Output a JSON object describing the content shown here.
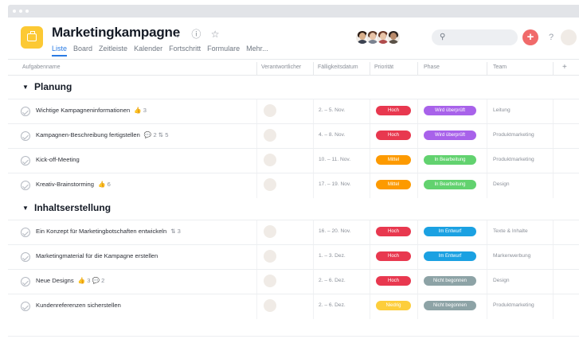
{
  "window": {
    "controls": [
      "dot",
      "dot",
      "dot"
    ]
  },
  "header": {
    "title": "Marketingkampagne",
    "title_icons": [
      "chevron-down-icon",
      "info-icon",
      "star-icon"
    ],
    "tabs": [
      {
        "label": "Liste",
        "active": true
      },
      {
        "label": "Board",
        "active": false
      },
      {
        "label": "Zeitleiste",
        "active": false
      },
      {
        "label": "Kalender",
        "active": false
      },
      {
        "label": "Fortschritt",
        "active": false
      },
      {
        "label": "Formulare",
        "active": false
      },
      {
        "label": "Mehr...",
        "active": false
      }
    ],
    "search": {
      "placeholder": ""
    },
    "plus_label": "+",
    "help_label": "?"
  },
  "columns": {
    "task": "Aufgabenname",
    "assignee": "Verantwortlicher",
    "due": "Fälligkeitsdatum",
    "priority": "Priorität",
    "phase": "Phase",
    "team": "Team",
    "add": "+"
  },
  "colors": {
    "hoch": "#e8384f",
    "mittel": "#fd9a00",
    "niedrig": "#fdce3c",
    "wird_ueberprueft": "#a862ea",
    "in_bearbeitung": "#62d26f",
    "im_entwurf": "#1ba1e2",
    "nicht_begonnen": "#8da3a6",
    "accent": "#2a7be4"
  },
  "sections": [
    {
      "title": "Planung",
      "tasks": [
        {
          "name": "Wichtige Kampagneninformationen",
          "meta": "👍 3",
          "due": "2. – 5. Nov.",
          "priority": "Hoch",
          "priority_color": "#e8384f",
          "phase": "Wird überprüft",
          "phase_color": "#a862ea",
          "team": "Leitung",
          "avatar": {
            "skin": "#d9b08c",
            "hair": "#2a1c15",
            "shirt": "#3b4250"
          }
        },
        {
          "name": "Kampagnen-Beschreibung fertigstellen",
          "meta": "💬 2  ⇅ 5",
          "due": "4. – 8. Nov.",
          "priority": "Hoch",
          "priority_color": "#e8384f",
          "phase": "Wird überprüft",
          "phase_color": "#a862ea",
          "team": "Produktmarketing",
          "avatar": {
            "skin": "#e8c4a8",
            "hair": "#4a2b1f",
            "shirt": "#c05757"
          }
        },
        {
          "name": "Kick-off-Meeting",
          "meta": "",
          "due": "10. – 11. Nov.",
          "priority": "Mittel",
          "priority_color": "#fd9a00",
          "phase": "In Bearbeitung",
          "phase_color": "#62d26f",
          "team": "Produktmarketing",
          "avatar": {
            "skin": "#d9b08c",
            "hair": "#2a1c15",
            "shirt": "#3b4250"
          }
        },
        {
          "name": "Kreativ-Brainstorming",
          "meta": "👍 6",
          "due": "17. – 19. Nov.",
          "priority": "Mittel",
          "priority_color": "#fd9a00",
          "phase": "In Bearbeitung",
          "phase_color": "#62d26f",
          "team": "Design",
          "avatar": {
            "skin": "#b98a6a",
            "hair": "#2d2420",
            "shirt": "#5a5147"
          }
        }
      ]
    },
    {
      "title": "Inhaltserstellung",
      "tasks": [
        {
          "name": "Ein Konzept für Marketingbotschaften entwickeln",
          "meta": "⇅ 3",
          "due": "16. – 20. Nov.",
          "priority": "Hoch",
          "priority_color": "#e8384f",
          "phase": "Im Entwurf",
          "phase_color": "#1ba1e2",
          "team": "Texte & Inhalte",
          "avatar": {
            "skin": "#e8c4a8",
            "hair": "#6b3a2a",
            "shirt": "#b04c4c"
          }
        },
        {
          "name": "Marketingmaterial für die Kampagne erstellen",
          "meta": "",
          "due": "1. – 3. Dez.",
          "priority": "Hoch",
          "priority_color": "#e8384f",
          "phase": "Im Entwurf",
          "phase_color": "#1ba1e2",
          "team": "Markenwerbung",
          "avatar": {
            "skin": "#c99a78",
            "hair": "#3a2a22",
            "shirt": "#6a7280"
          }
        },
        {
          "name": "Neue Designs",
          "meta": "👍 3  💬 2",
          "due": "2. – 6. Dez.",
          "priority": "Hoch",
          "priority_color": "#e8384f",
          "phase": "Nicht begonnen",
          "phase_color": "#8da3a6",
          "team": "Design",
          "avatar": {
            "skin": "#b98a6a",
            "hair": "#2d2420",
            "shirt": "#8a7a5a"
          }
        },
        {
          "name": "Kundenreferenzen sicherstellen",
          "meta": "",
          "due": "2. – 6. Dez.",
          "priority": "Niedrig",
          "priority_color": "#fdce3c",
          "phase": "Nicht begonnen",
          "phase_color": "#8da3a6",
          "team": "Produktmarketing",
          "avatar": {
            "skin": "#d9b08c",
            "hair": "#2a1c15",
            "shirt": "#3b4250"
          }
        }
      ]
    }
  ],
  "header_members": [
    {
      "skin": "#d9b08c",
      "hair": "#2a1c15",
      "shirt": "#3b4250"
    },
    {
      "skin": "#e8c4a8",
      "hair": "#5c3a2a",
      "shirt": "#7a8290"
    },
    {
      "skin": "#e8c4a8",
      "hair": "#6b3a2a",
      "shirt": "#b04c4c"
    },
    {
      "skin": "#b98a6a",
      "hair": "#2d2420",
      "shirt": "#5a5147"
    }
  ],
  "me_avatar": {
    "skin": "#d9b08c",
    "hair": "#2a1c15",
    "shirt": "#3b4250"
  }
}
